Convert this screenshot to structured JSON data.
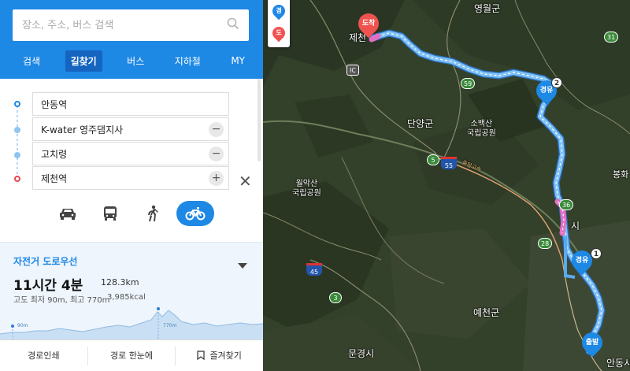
{
  "search": {
    "placeholder": "장소, 주소, 버스 검색"
  },
  "tabs": [
    {
      "label": "검색"
    },
    {
      "label": "길찾기"
    },
    {
      "label": "버스"
    },
    {
      "label": "지하철"
    },
    {
      "label": "MY"
    }
  ],
  "waypoints": [
    {
      "value": "안동역",
      "type": "start"
    },
    {
      "value": "K-water 영주댐지사",
      "type": "via",
      "action": "−"
    },
    {
      "value": "고치령",
      "type": "via",
      "action": "−"
    },
    {
      "value": "제천역",
      "type": "end",
      "action": "+"
    }
  ],
  "close_symbol": "✕",
  "modes": [
    {
      "name": "car",
      "active": false
    },
    {
      "name": "bus",
      "active": false
    },
    {
      "name": "walk",
      "active": false
    },
    {
      "name": "bicycle",
      "active": true
    }
  ],
  "result": {
    "route_type": "자전거 도로우선",
    "time": "11시간 4분",
    "distance": "128.3km",
    "elevation": "고도 최저 90m, 최고 770m",
    "kcal": "3,985kcal",
    "elev_min_label": "90m",
    "elev_max_label": "770m"
  },
  "bottom": {
    "print": "경로인쇄",
    "overview": "경로 한눈에",
    "favorite": "즐겨찾기"
  },
  "map": {
    "side_pins": [
      {
        "text": "경"
      },
      {
        "text": "도"
      }
    ],
    "labels": {
      "yeongwol": "영월군",
      "jecheon": "제천",
      "danyang": "단양군",
      "sobaek": "소백산\n국립공원",
      "worak": "월악산\n국립공원",
      "yecheon": "예천군",
      "mungyeong": "문경시",
      "andong": "안동시",
      "bonghwa": "봉화",
      "yeongju_si": "시",
      "expressway_name": "중앙고속"
    },
    "shields": [
      "5",
      "59",
      "31",
      "36",
      "28",
      "3",
      "IC"
    ],
    "expressway_shields": [
      "55",
      "45"
    ],
    "pins": {
      "arrive": "도착",
      "via1": "경유",
      "via2": "경유",
      "depart": "출발"
    },
    "badges": [
      "1",
      "2"
    ]
  },
  "colors": {
    "brand": "#1e88e5",
    "route": "#5aa9f0",
    "route_alt": "#f27ed0",
    "arrive_pin": "#ef5350",
    "via_pin": "#1e88e5"
  }
}
